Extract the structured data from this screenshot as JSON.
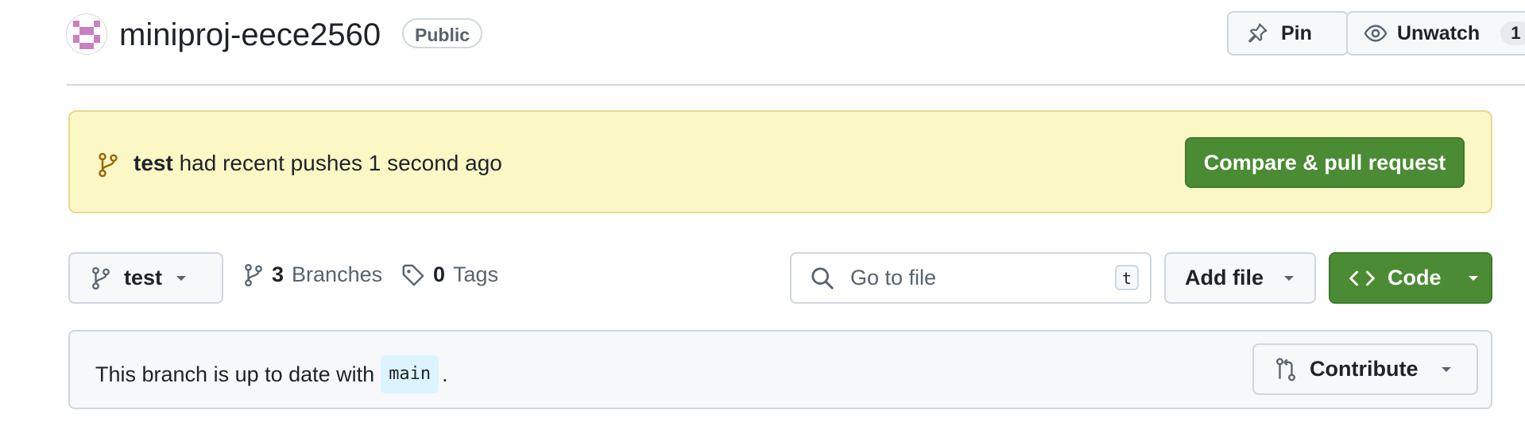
{
  "header": {
    "repo_name": "miniproj-eece2560",
    "visibility": "Public",
    "pin_label": "Pin",
    "unwatch_label": "Unwatch",
    "watch_count": "1"
  },
  "banner": {
    "branch": "test",
    "message": "had recent pushes 1 second ago",
    "compare_label": "Compare & pull request"
  },
  "toolbar": {
    "current_branch": "test",
    "branches_count": "3",
    "branches_label": "Branches",
    "tags_count": "0",
    "tags_label": "Tags",
    "search_placeholder": "Go to file",
    "search_shortcut": "t",
    "add_file_label": "Add file",
    "code_label": "Code"
  },
  "status": {
    "prefix": "This branch is up to date with",
    "base_branch": "main",
    "suffix": ".",
    "contribute_label": "Contribute"
  },
  "colors": {
    "primary_green": "#4b8b34",
    "banner_yellow": "#fbf8c6",
    "avatar_pink": "#c980c0"
  },
  "icons": [
    "avatar-identicon",
    "pin-icon",
    "eye-icon",
    "git-branch-icon",
    "tag-icon",
    "search-icon",
    "caret-down-icon",
    "code-icon",
    "git-compare-icon"
  ]
}
